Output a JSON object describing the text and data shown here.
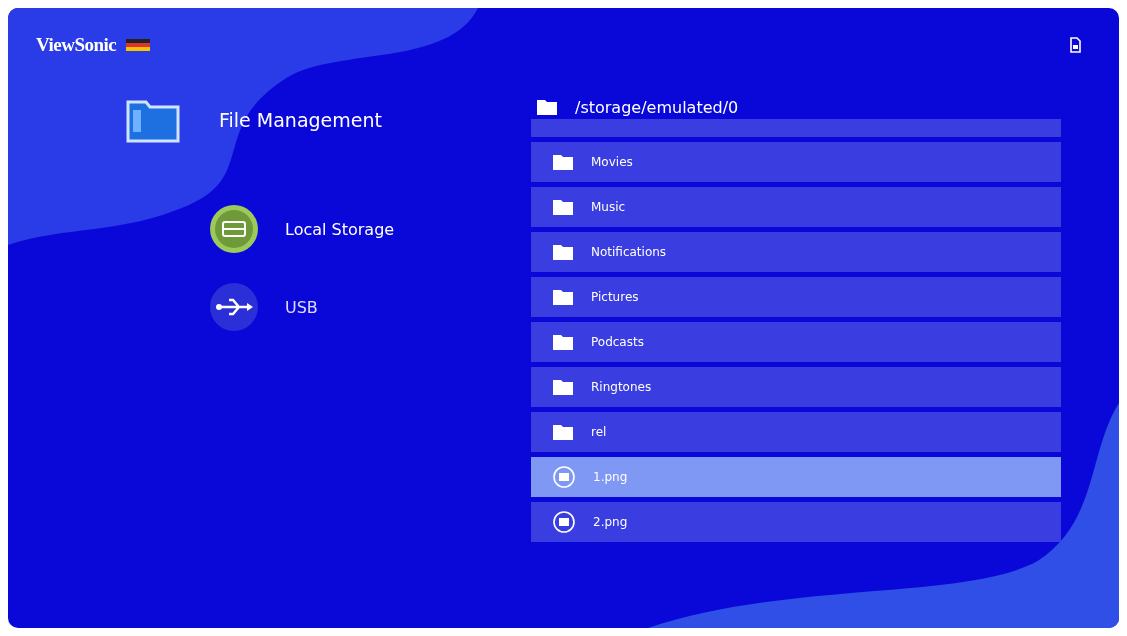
{
  "brand": {
    "logo": "ViewSonic"
  },
  "page": {
    "title": "File Management"
  },
  "sources": [
    {
      "label": "Local Storage",
      "kind": "storage",
      "selected": true
    },
    {
      "label": "USB",
      "kind": "usb",
      "selected": false
    }
  ],
  "browser": {
    "path": "/storage/emulated/0",
    "items": [
      {
        "name": "Movies",
        "kind": "folder",
        "selected": false
      },
      {
        "name": "Music",
        "kind": "folder",
        "selected": false
      },
      {
        "name": "Notifications",
        "kind": "folder",
        "selected": false
      },
      {
        "name": "Pictures",
        "kind": "folder",
        "selected": false
      },
      {
        "name": "Podcasts",
        "kind": "folder",
        "selected": false
      },
      {
        "name": "Ringtones",
        "kind": "folder",
        "selected": false
      },
      {
        "name": "rel",
        "kind": "folder",
        "selected": false
      },
      {
        "name": "1.png",
        "kind": "image",
        "selected": true
      },
      {
        "name": "2.png",
        "kind": "image",
        "selected": false
      }
    ]
  }
}
